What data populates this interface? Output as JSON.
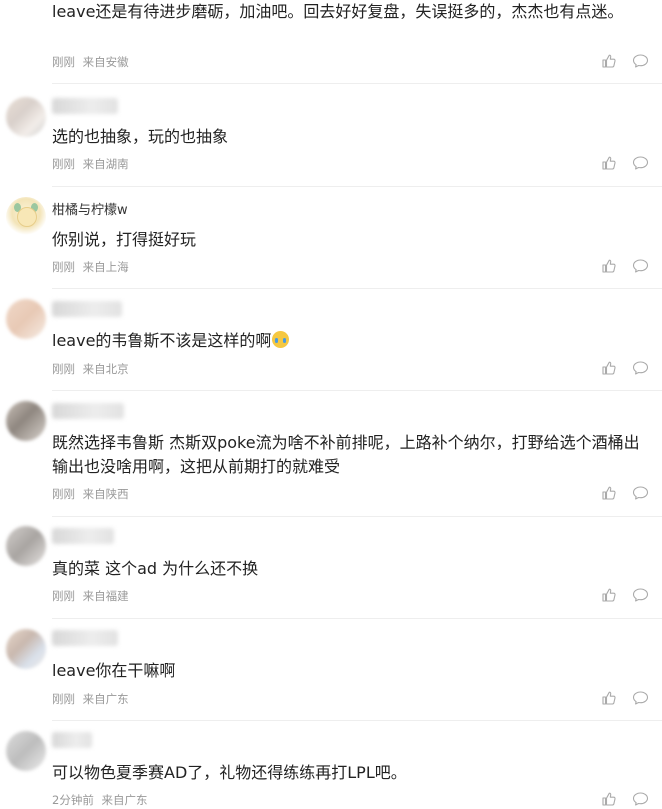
{
  "comments": [
    {
      "name": "",
      "text": "leave还是有待进步磨砺，加油吧。回去好好复盘，失误挺多的，杰杰也有点迷。",
      "time": "刚刚",
      "location": "来自安徽"
    },
    {
      "name": "",
      "text": "选的也抽象，玩的也抽象",
      "time": "刚刚",
      "location": "来自湖南"
    },
    {
      "name": "柑橘与柠檬w",
      "text": "你别说，打得挺好玩",
      "time": "刚刚",
      "location": "来自上海"
    },
    {
      "name": "",
      "text": "leave的韦鲁斯不该是这样的啊",
      "emoji": "crying-emoji",
      "time": "刚刚",
      "location": "来自北京"
    },
    {
      "name": "",
      "text": "既然选择韦鲁斯 杰斯双poke流为啥不补前排呢，上路补个纳尔，打野给选个酒桶出输出也没啥用啊，这把从前期打的就难受",
      "time": "刚刚",
      "location": "来自陕西"
    },
    {
      "name": "",
      "text": "真的菜 这个ad 为什么还不换",
      "time": "刚刚",
      "location": "来自福建"
    },
    {
      "name": "",
      "text": "leave你在干嘛啊",
      "time": "刚刚",
      "location": "来自广东"
    },
    {
      "name": "",
      "text": "可以物色夏季赛AD了，礼物还得练练再打LPL吧。",
      "time": "2分钟前",
      "location": "来自广东"
    }
  ],
  "icons": {
    "like": "thumbs-up-icon",
    "reply": "speech-bubble-icon"
  },
  "colors": {
    "text": "#222222",
    "meta": "#999999",
    "divider": "#eeeeee",
    "icon": "#aaaaaa"
  }
}
